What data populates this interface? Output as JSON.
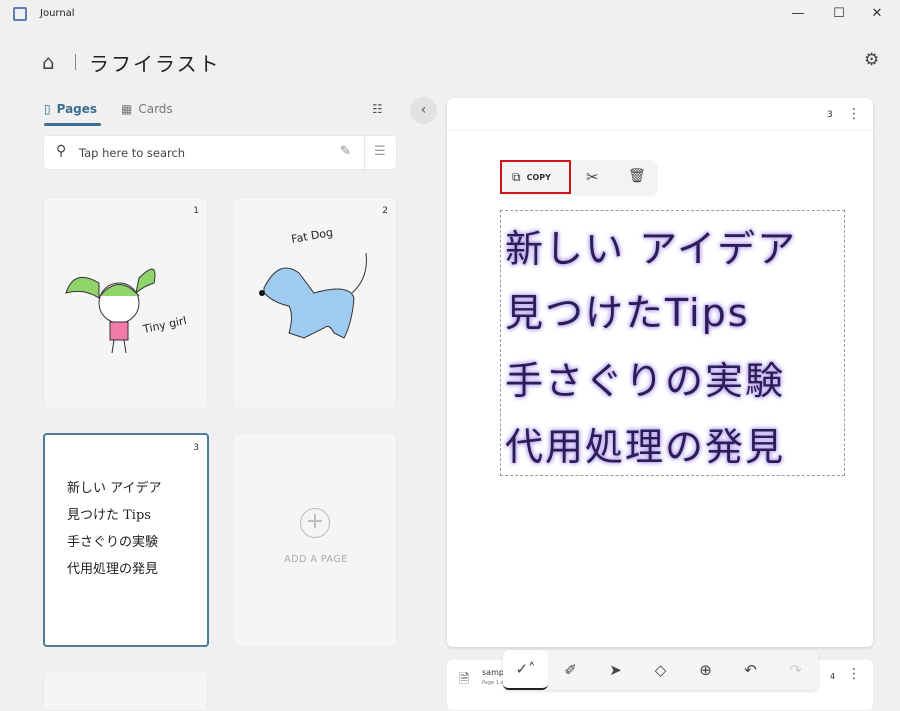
{
  "window": {
    "title": "Journal",
    "controls": [
      "—",
      "☐",
      "✕"
    ]
  },
  "header": {
    "title": "ラフイラスト",
    "home_icon": "home-icon",
    "settings_icon": "gear-icon"
  },
  "tabs": [
    {
      "label": "Pages",
      "active": true
    },
    {
      "label": "Cards",
      "active": false
    }
  ],
  "search": {
    "placeholder": "Tap here to search"
  },
  "pages": [
    {
      "number": "1",
      "drawing_text": "Tiny girl"
    },
    {
      "number": "2",
      "drawing_text": "Fat Dog"
    },
    {
      "number": "3",
      "lines": [
        "新しい アイデア",
        "見つけた Tips",
        "手さぐりの実験",
        "代用処理の発見"
      ]
    }
  ],
  "add_page": {
    "label": "ADD A PAGE"
  },
  "editor": {
    "page_number": "3",
    "selection_toolbar": {
      "copy_label": "COPY"
    },
    "lines": [
      "新しい アイデア",
      "見つけたTips",
      "手さぐりの実験",
      "代用処理の発見"
    ],
    "ink_glow_color": "#b7a6ef"
  },
  "next_document": {
    "name": "samp",
    "subtitle": "Page 1 of 1",
    "page_number": "4"
  },
  "drawing_toolbar": {
    "tools": [
      "pen",
      "highlighter",
      "pointer",
      "eraser",
      "add",
      "undo",
      "redo"
    ]
  }
}
